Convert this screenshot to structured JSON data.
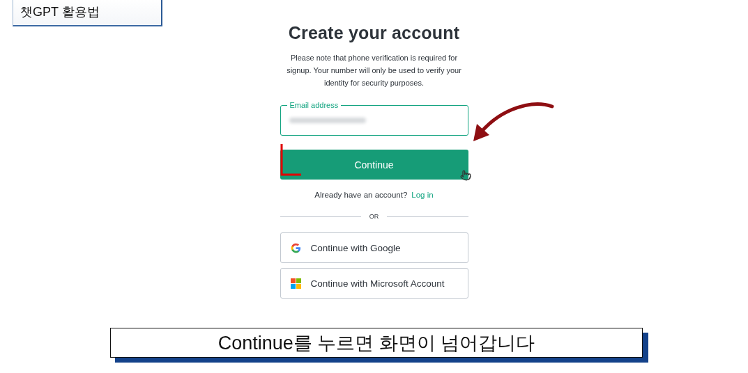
{
  "header_tag": "챗GPT 활용법",
  "title": "Create your account",
  "notice": "Please note that phone verification is required for signup. Your number will only be used to verify your identity for security purposes.",
  "email_field": {
    "label": "Email address",
    "blurred": true
  },
  "continue_button": "Continue",
  "login_prompt": {
    "text": "Already have an account?",
    "link": "Log in"
  },
  "divider": "OR",
  "providers": [
    {
      "kind": "google",
      "label": "Continue with Google"
    },
    {
      "kind": "microsoft",
      "label": "Continue with Microsoft Account"
    }
  ],
  "caption": "Continue를 누르면 화면이 넘어갑니다"
}
